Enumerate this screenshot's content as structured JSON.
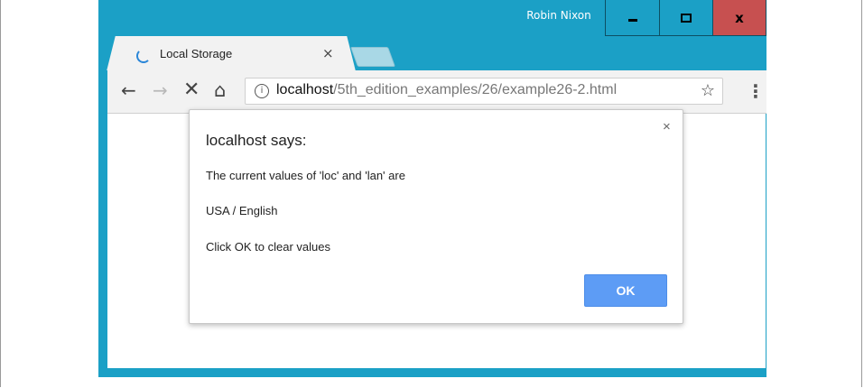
{
  "window": {
    "user_name": "Robin Nixon",
    "minimize_icon": "minimize-icon",
    "maximize_icon": "maximize-icon",
    "close_icon": "close-icon",
    "close_label": "x",
    "accent_color": "#1ba0c6",
    "close_color": "#c75050"
  },
  "tab": {
    "title": "Local Storage",
    "close_label": "×",
    "loading_icon": "loading-spinner-icon"
  },
  "toolbar": {
    "back": "←",
    "forward": "→",
    "stop": "✕",
    "home": "⌂",
    "info": "i",
    "url_host": "localhost",
    "url_path": "/5th_edition_examples/26/example26-2.html",
    "star": "☆",
    "menu": "⋮"
  },
  "dialog": {
    "title": "localhost says:",
    "close_label": "×",
    "line1": "The current values of 'loc' and 'lan' are",
    "line2": "USA / English",
    "line3": "Click OK to clear values",
    "ok_label": "OK",
    "button_color": "#5d9cf5"
  }
}
